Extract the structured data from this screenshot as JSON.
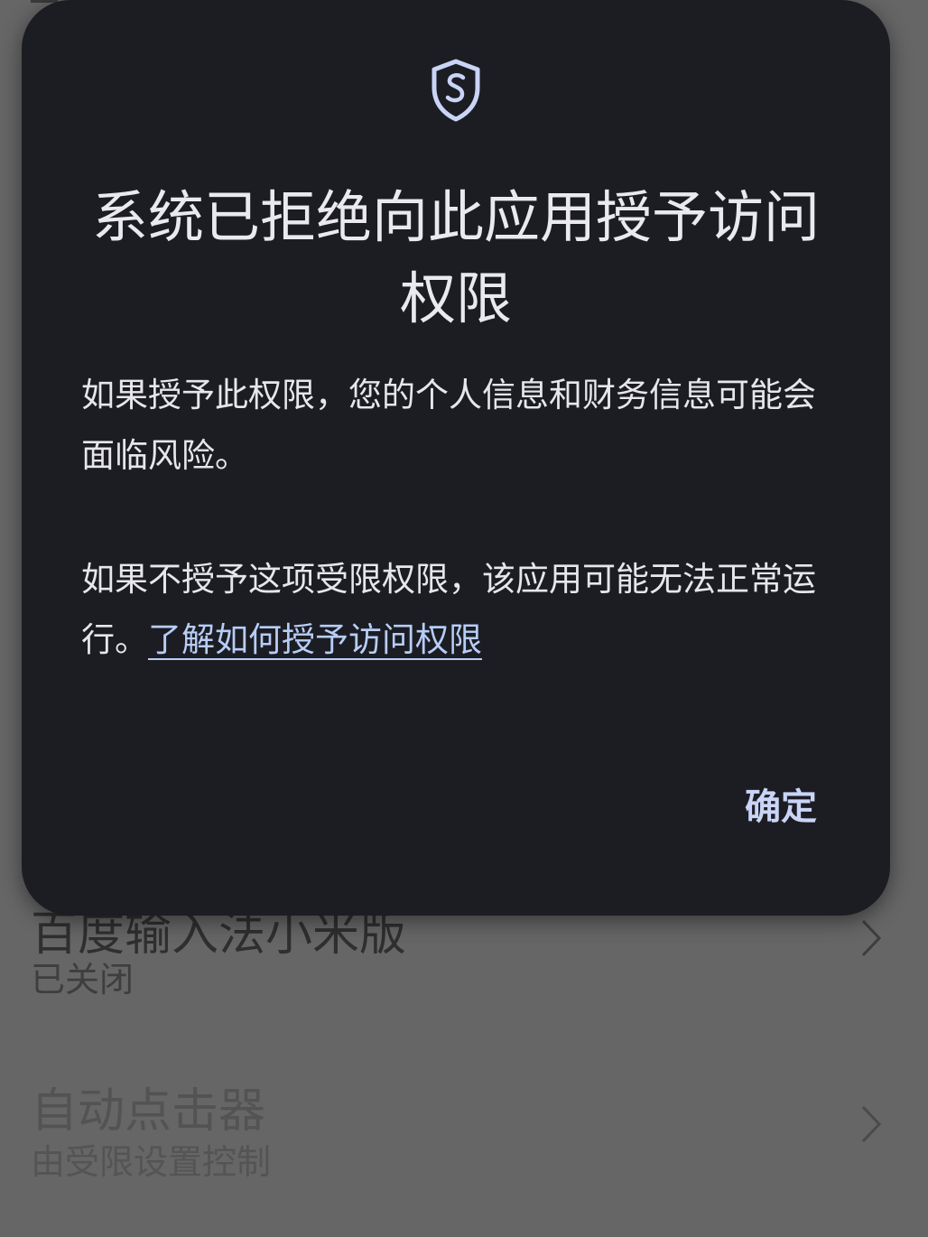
{
  "background_list": {
    "items": [
      {
        "title": "百度输入法小米版",
        "subtitle": "已关闭"
      },
      {
        "title": "自动点击器",
        "subtitle": "由受限设置控制"
      }
    ]
  },
  "dialog": {
    "icon": "shield-icon",
    "title": "系统已拒绝向此应用授予访问权限",
    "body_1": "如果授予此权限，您的个人信息和财务信息可能会面临风险。",
    "body_2_text": "如果不授予这项受限权限，该应用可能无法正常运行。",
    "body_2_link": "了解如何授予访问权限",
    "ok_label": "确定"
  },
  "colors": {
    "scrim": "#666666",
    "dialog_bg": "#1c1d22",
    "dialog_text": "#e6e6ec",
    "link": "#b7cdf8",
    "accent_button": "#c9d4f6"
  }
}
